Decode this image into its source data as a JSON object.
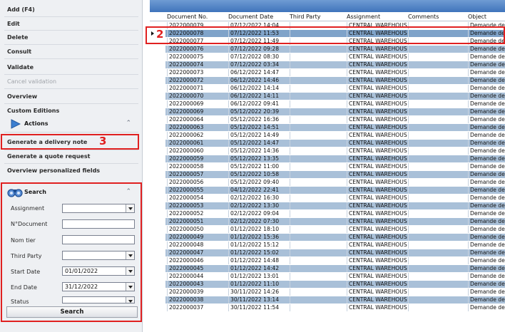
{
  "left_panel": {
    "menu": {
      "add": "Add (F4)",
      "edit": "Edit",
      "delete": "Delete",
      "consult": "Consult",
      "validate": "Validate",
      "cancel_validation": "Cancel validation",
      "overview": "Overview",
      "custom_editions": "Custom Editions"
    },
    "actions": {
      "title": "Actions",
      "generate_delivery_note": "Generate a delivery note",
      "generate_quote_request": "Generate a quote request",
      "overview_personalized_fields": "Overview personalized fields"
    },
    "search": {
      "title": "Search",
      "fields": {
        "assignment": {
          "label": "Assignment",
          "value": ""
        },
        "document_no": {
          "label": "N°Document",
          "value": ""
        },
        "nom_tier": {
          "label": "Nom tier",
          "value": ""
        },
        "third_party": {
          "label": "Third Party",
          "value": ""
        },
        "start_date": {
          "label": "Start Date",
          "value": "01/01/2022"
        },
        "end_date": {
          "label": "End Date",
          "value": "31/12/2022"
        },
        "status": {
          "label": "Status",
          "value": ""
        }
      },
      "button": "Search"
    }
  },
  "annotations": {
    "marker_2": "2",
    "marker_3": "3"
  },
  "colors": {
    "highlight": "#e02020",
    "accent": "#3f74bb",
    "row_alt": "#a9c0d8"
  },
  "grid": {
    "columns": [
      "Document No.",
      "Document Date",
      "Third Party",
      "Assignment",
      "Comments",
      "Object"
    ],
    "rows": [
      [
        "2022000079",
        "07/12/2022 14:04",
        "",
        "CENTRAL WAREHOUS",
        "",
        "Demande de"
      ],
      [
        "2022000078",
        "07/12/2022 11:53",
        "",
        "CENTRAL WAREHOUS",
        "",
        "Demande de"
      ],
      [
        "2022000077",
        "07/12/2022 11:49",
        "",
        "CENTRAL WAREHOUS",
        "",
        "Demande de"
      ],
      [
        "2022000076",
        "07/12/2022 09:28",
        "",
        "CENTRAL WAREHOUS",
        "",
        "Demande de"
      ],
      [
        "2022000075",
        "07/12/2022 08:30",
        "",
        "CENTRAL WAREHOUS",
        "",
        "Demande de"
      ],
      [
        "2022000074",
        "07/12/2022 03:34",
        "",
        "CENTRAL WAREHOUS",
        "",
        "Demande de"
      ],
      [
        "2022000073",
        "06/12/2022 14:47",
        "",
        "CENTRAL WAREHOUS",
        "",
        "Demande de"
      ],
      [
        "2022000072",
        "06/12/2022 14:46",
        "",
        "CENTRAL WAREHOUS",
        "",
        "Demande de"
      ],
      [
        "2022000071",
        "06/12/2022 14:14",
        "",
        "CENTRAL WAREHOUS",
        "",
        "Demande de"
      ],
      [
        "2022000070",
        "06/12/2022 14:11",
        "",
        "CENTRAL WAREHOUS",
        "",
        "Demande de"
      ],
      [
        "2022000069",
        "06/12/2022 09:41",
        "",
        "CENTRAL WAREHOUS",
        "",
        "Demande de"
      ],
      [
        "2022000069",
        "05/12/2022 20:39",
        "",
        "CENTRAL WAREHOUS",
        "",
        "Demande de"
      ],
      [
        "2022000064",
        "05/12/2022 16:36",
        "",
        "CENTRAL WAREHOUS",
        "",
        "Demande de"
      ],
      [
        "2022000063",
        "05/12/2022 14:51",
        "",
        "CENTRAL WAREHOUS",
        "",
        "Demande de"
      ],
      [
        "2022000062",
        "05/12/2022 14:49",
        "",
        "CENTRAL WAREHOUS",
        "",
        "Demande de"
      ],
      [
        "2022000061",
        "05/12/2022 14:47",
        "",
        "CENTRAL WAREHOUS",
        "",
        "Demande de"
      ],
      [
        "2022000060",
        "05/12/2022 14:36",
        "",
        "CENTRAL WAREHOUS",
        "",
        "Demande de"
      ],
      [
        "2022000059",
        "05/12/2022 13:35",
        "",
        "CENTRAL WAREHOUS",
        "",
        "Demande de"
      ],
      [
        "2022000058",
        "05/12/2022 11:00",
        "",
        "CENTRAL WAREHOUS",
        "",
        "Demande de"
      ],
      [
        "2022000057",
        "05/12/2022 10:58",
        "",
        "CENTRAL WAREHOUS",
        "",
        "Demande de"
      ],
      [
        "2022000056",
        "05/12/2022 09:40",
        "",
        "CENTRAL WAREHOUS",
        "",
        "Demande de"
      ],
      [
        "2022000055",
        "04/12/2022 22:41",
        "",
        "CENTRAL WAREHOUS",
        "",
        "Demande de"
      ],
      [
        "2022000054",
        "02/12/2022 16:30",
        "",
        "CENTRAL WAREHOUS",
        "",
        "Demande de"
      ],
      [
        "2022000053",
        "02/12/2022 13:30",
        "",
        "CENTRAL WAREHOUS",
        "",
        "Demande de"
      ],
      [
        "2022000052",
        "02/12/2022 09:04",
        "",
        "CENTRAL WAREHOUS",
        "",
        "Demande de"
      ],
      [
        "2022000051",
        "02/12/2022 07:30",
        "",
        "CENTRAL WAREHOUS",
        "",
        "Demande de"
      ],
      [
        "2022000050",
        "01/12/2022 18:10",
        "",
        "CENTRAL WAREHOUS",
        "",
        "Demande de"
      ],
      [
        "2022000049",
        "01/12/2022 15:36",
        "",
        "CENTRAL WAREHOUS",
        "",
        "Demande de"
      ],
      [
        "2022000048",
        "01/12/2022 15:12",
        "",
        "CENTRAL WAREHOUS",
        "",
        "Demande de"
      ],
      [
        "2022000047",
        "01/12/2022 15:02",
        "",
        "CENTRAL WAREHOUS",
        "",
        "Demande de"
      ],
      [
        "2022000046",
        "01/12/2022 14:48",
        "",
        "CENTRAL WAREHOUS",
        "",
        "Demande de"
      ],
      [
        "2022000045",
        "01/12/2022 14:42",
        "",
        "CENTRAL WAREHOUS",
        "",
        "Demande de"
      ],
      [
        "2022000044",
        "01/12/2022 13:01",
        "",
        "CENTRAL WAREHOUS",
        "",
        "Demande de"
      ],
      [
        "2022000043",
        "01/12/2022 11:10",
        "",
        "CENTRAL WAREHOUS",
        "",
        "Demande de"
      ],
      [
        "2022000039",
        "30/11/2022 14:26",
        "",
        "CENTRAL WAREHOUS",
        "",
        "Demande de"
      ],
      [
        "2022000038",
        "30/11/2022 13:14",
        "",
        "CENTRAL WAREHOUS",
        "",
        "Demande de"
      ],
      [
        "2022000037",
        "30/11/2022 11:54",
        "",
        "CENTRAL WAREHOUS",
        "",
        "Demande de"
      ]
    ]
  }
}
